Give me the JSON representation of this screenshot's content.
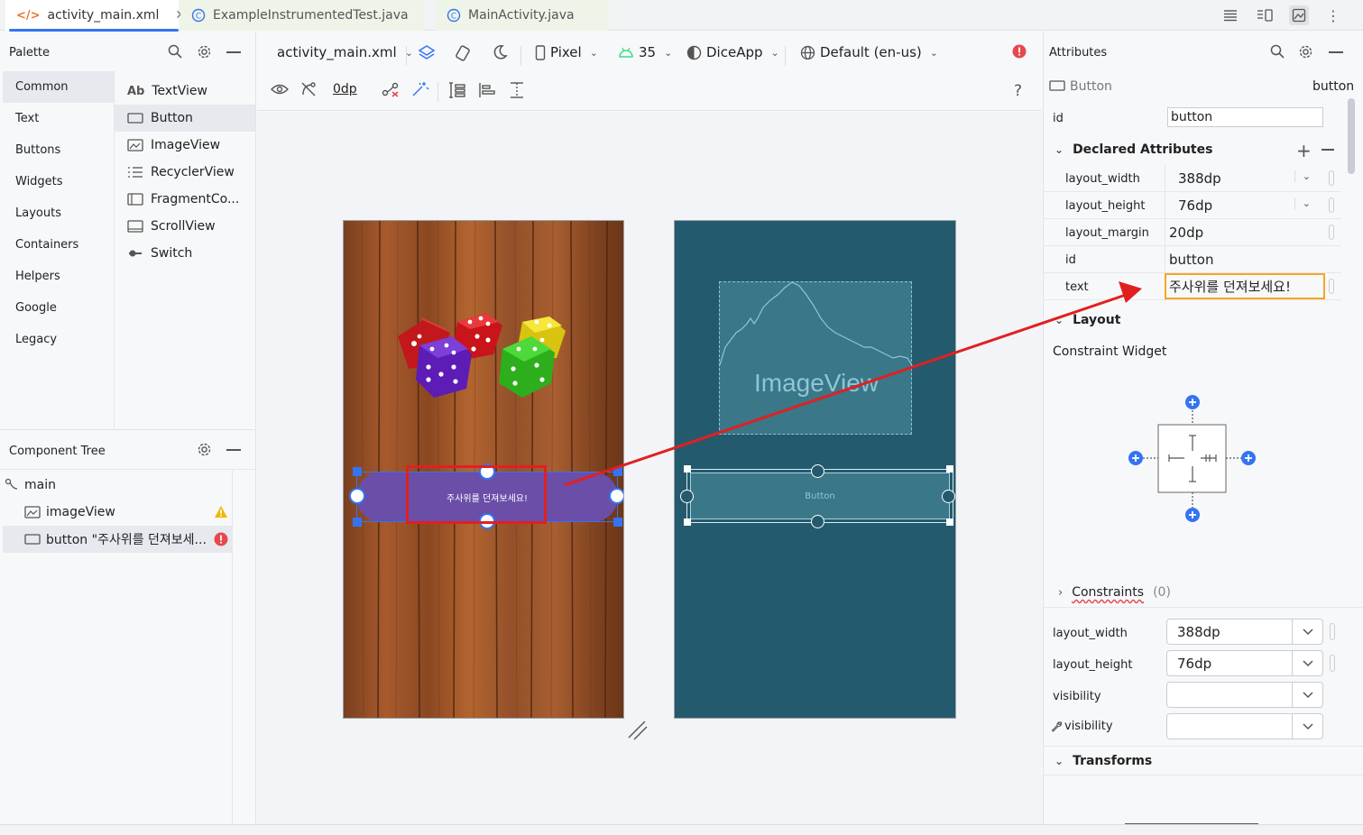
{
  "tabs": [
    {
      "label": "activity_main.xml",
      "active": true
    },
    {
      "label": "ExampleInstrumentedTest.java",
      "active": false
    },
    {
      "label": "MainActivity.java",
      "active": false
    }
  ],
  "palette": {
    "title": "Palette",
    "categories": [
      "Common",
      "Text",
      "Buttons",
      "Widgets",
      "Layouts",
      "Containers",
      "Helpers",
      "Google",
      "Legacy"
    ],
    "items": [
      "TextView",
      "Button",
      "ImageView",
      "RecyclerView",
      "FragmentCo...",
      "ScrollView",
      "Switch"
    ],
    "textview_prefix": "Ab"
  },
  "tree": {
    "title": "Component Tree",
    "rows": [
      "main",
      "imageView",
      "button \"주사위를 던져보세..."
    ]
  },
  "designbar": {
    "file": "activity_main.xml",
    "device": "Pixel",
    "api": "35",
    "theme": "DiceApp",
    "locale": "Default (en-us)",
    "margin": "0dp",
    "help": "?"
  },
  "design": {
    "button_text": "주사위를 던져보세요!"
  },
  "blueprint": {
    "image_label": "ImageView",
    "button_label": "Button"
  },
  "attributes": {
    "title": "Attributes",
    "widget_type": "Button",
    "widget_name": "button",
    "id_label": "id",
    "id_value": "button",
    "declared_title": "Declared Attributes",
    "declared": [
      {
        "name": "layout_width",
        "value": "388dp"
      },
      {
        "name": "layout_height",
        "value": "76dp"
      },
      {
        "name": "layout_margin",
        "value": "20dp"
      },
      {
        "name": "id",
        "value": "button"
      },
      {
        "name": "text",
        "value": "주사위를 던져보세요!"
      }
    ],
    "layout_title": "Layout",
    "constraint_widget": "Constraint Widget",
    "constraints_label": "Constraints",
    "constraints_count": "(0)",
    "layout_fields": [
      {
        "name": "layout_width",
        "value": "388dp"
      },
      {
        "name": "layout_height",
        "value": "76dp"
      },
      {
        "name": "visibility",
        "value": ""
      },
      {
        "name": "visibility",
        "value": ""
      }
    ],
    "transforms_title": "Transforms"
  },
  "colors": {
    "accent": "#3574f0",
    "button_purple": "#6a4ea8",
    "blueprint_bg": "#245a6e",
    "annotation_red": "#e02020",
    "focus_orange": "#f5a623"
  }
}
